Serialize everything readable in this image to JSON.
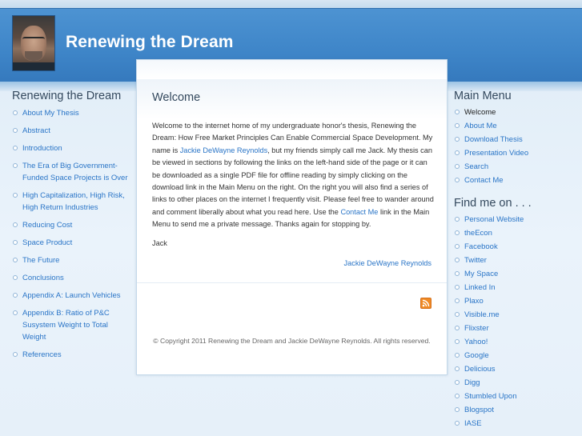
{
  "site": {
    "title": "Renewing the Dream"
  },
  "left_menu": {
    "title": "Renewing the Dream",
    "items": [
      "About My Thesis",
      "Abstract",
      "Introduction",
      "The Era of Big Government-Funded Space Projects is Over",
      "High Capitalization, High Risk, High Return Industries",
      "Reducing Cost",
      "Space Product",
      "The Future",
      "Conclusions",
      "Appendix A: Launch Vehicles",
      "Appendix B: Ratio of P&C Susystem Weight to Total Weight",
      "References"
    ]
  },
  "content": {
    "heading": "Welcome",
    "paragraph": {
      "part1": "Welcome to the internet home of my undergraduate honor's thesis, Renewing the Dream: How Free Market Principles Can Enable Commercial Space Development. My name is ",
      "link1": "Jackie DeWayne Reynolds",
      "part2": ", but my friends simply call me Jack. My thesis can be viewed in sections by following the links on the left-hand side of the page or it can be downloaded as a single PDF file for offline reading by simply clicking on the download link in the Main Menu on the right. On the right you will also find a series of links to other places on the internet I frequently visit. Please feel free to wander around and comment liberally about what you read here. Use the ",
      "link2": "Contact Me",
      "part3": " link in the Main Menu to send me a private message. Thanks again for stopping by."
    },
    "sign_off": "Jack",
    "author_link": "Jackie DeWayne Reynolds",
    "copyright": "© Copyright 2011 Renewing the Dream and Jackie DeWayne Reynolds. All rights reserved."
  },
  "main_menu": {
    "title": "Main Menu",
    "items": [
      "Welcome",
      "About Me",
      "Download Thesis",
      "Presentation Video",
      "Search",
      "Contact Me"
    ],
    "active": "Welcome"
  },
  "find_me": {
    "title": "Find me on . . .",
    "items": [
      "Personal Website",
      "theEcon",
      "Facebook",
      "Twitter",
      "My Space",
      "Linked In",
      "Plaxo",
      "Visible.me",
      "Flixster",
      "Yahoo!",
      "Google",
      "Delicious",
      "Digg",
      "Stumbled Upon",
      "Blogspot",
      "IASE"
    ]
  },
  "icons": {
    "avatar": "author-photo",
    "feed": "rss-icon"
  },
  "colors": {
    "header": "#3e85c8",
    "link": "#2a75c7",
    "heading": "#34495e",
    "rss": "#f08a24"
  }
}
